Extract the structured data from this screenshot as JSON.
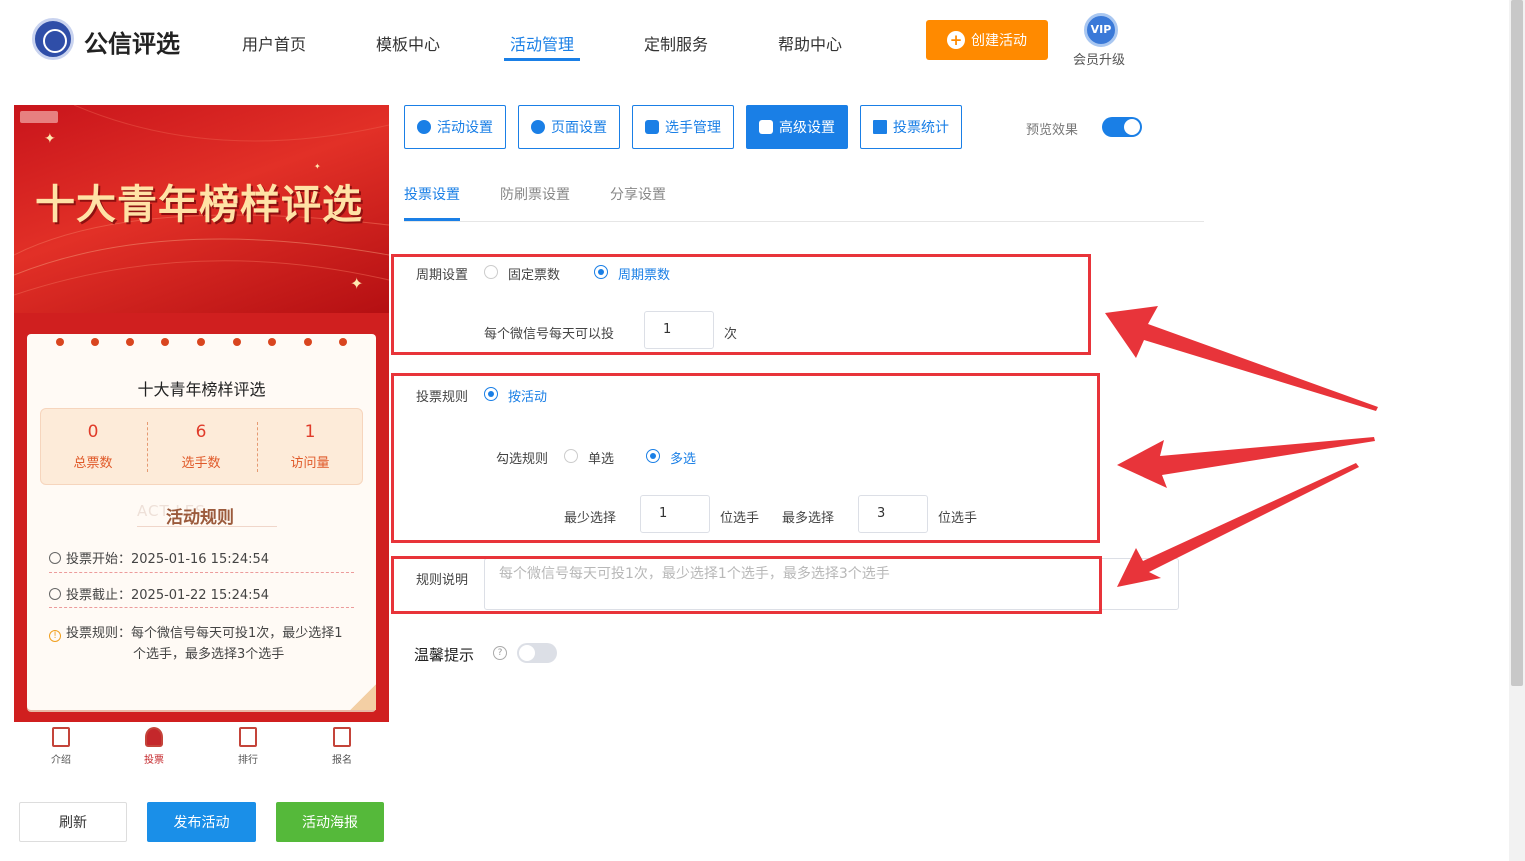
{
  "header": {
    "brand": "公信评选",
    "nav": [
      "用户首页",
      "模板中心",
      "活动管理",
      "定制服务",
      "帮助中心"
    ],
    "active_nav": "活动管理",
    "create_button": "创建活动",
    "vip_badge": "VIP",
    "vip_label": "会员升级"
  },
  "preview": {
    "banner_title": "十大青年榜样评选",
    "card_title": "十大青年榜样评选",
    "stats": [
      {
        "value": "0",
        "label": "总票数"
      },
      {
        "value": "6",
        "label": "选手数"
      },
      {
        "value": "1",
        "label": "访问量"
      }
    ],
    "rules_ghost": "ACT        LES",
    "rules_title": "活动规则",
    "vote_start": "投票开始：2025-01-16 15:24:54",
    "vote_end": "投票截止：2025-01-22 15:24:54",
    "vote_rule": "投票规则：每个微信号每天可投1次，最少选择1",
    "vote_rule_cont": "个选手，最多选择3个选手",
    "bottom_nav": [
      "介绍",
      "投票",
      "排行",
      "报名"
    ],
    "active_bottom_nav": "投票"
  },
  "actions": {
    "refresh": "刷新",
    "publish": "发布活动",
    "poster": "活动海报"
  },
  "settings_tabs": [
    "活动设置",
    "页面设置",
    "选手管理",
    "高级设置",
    "投票统计"
  ],
  "active_settings_tab": "高级设置",
  "preview_toggle_label": "预览效果",
  "preview_toggle_on": true,
  "sub_tabs": [
    "投票设置",
    "防刷票设置",
    "分享设置"
  ],
  "active_sub_tab": "投票设置",
  "form": {
    "cycle_label": "周期设置",
    "cycle_options": [
      "固定票数",
      "周期票数"
    ],
    "cycle_selected": "周期票数",
    "daily_label": "每个微信号每天可以投",
    "daily_value": "1",
    "daily_unit": "次",
    "vote_rule_label": "投票规则",
    "vote_rule_option": "按活动",
    "check_rule_label": "勾选规则",
    "check_options": [
      "单选",
      "多选"
    ],
    "check_selected": "多选",
    "min_label": "最少选择",
    "min_value": "1",
    "min_unit": "位选手",
    "max_label": "最多选择",
    "max_value": "3",
    "max_unit": "位选手",
    "desc_label": "规则说明",
    "desc_placeholder": "每个微信号每天可投1次，最少选择1个选手，最多选择3个选手",
    "tip_label": "温馨提示",
    "tip_help": "?",
    "tip_on": false
  },
  "colors": {
    "primary": "#1a7fe6",
    "orange": "#ff8a00",
    "green": "#55b93a",
    "highlight": "#e8343a",
    "banner_red": "#d01f1f"
  }
}
